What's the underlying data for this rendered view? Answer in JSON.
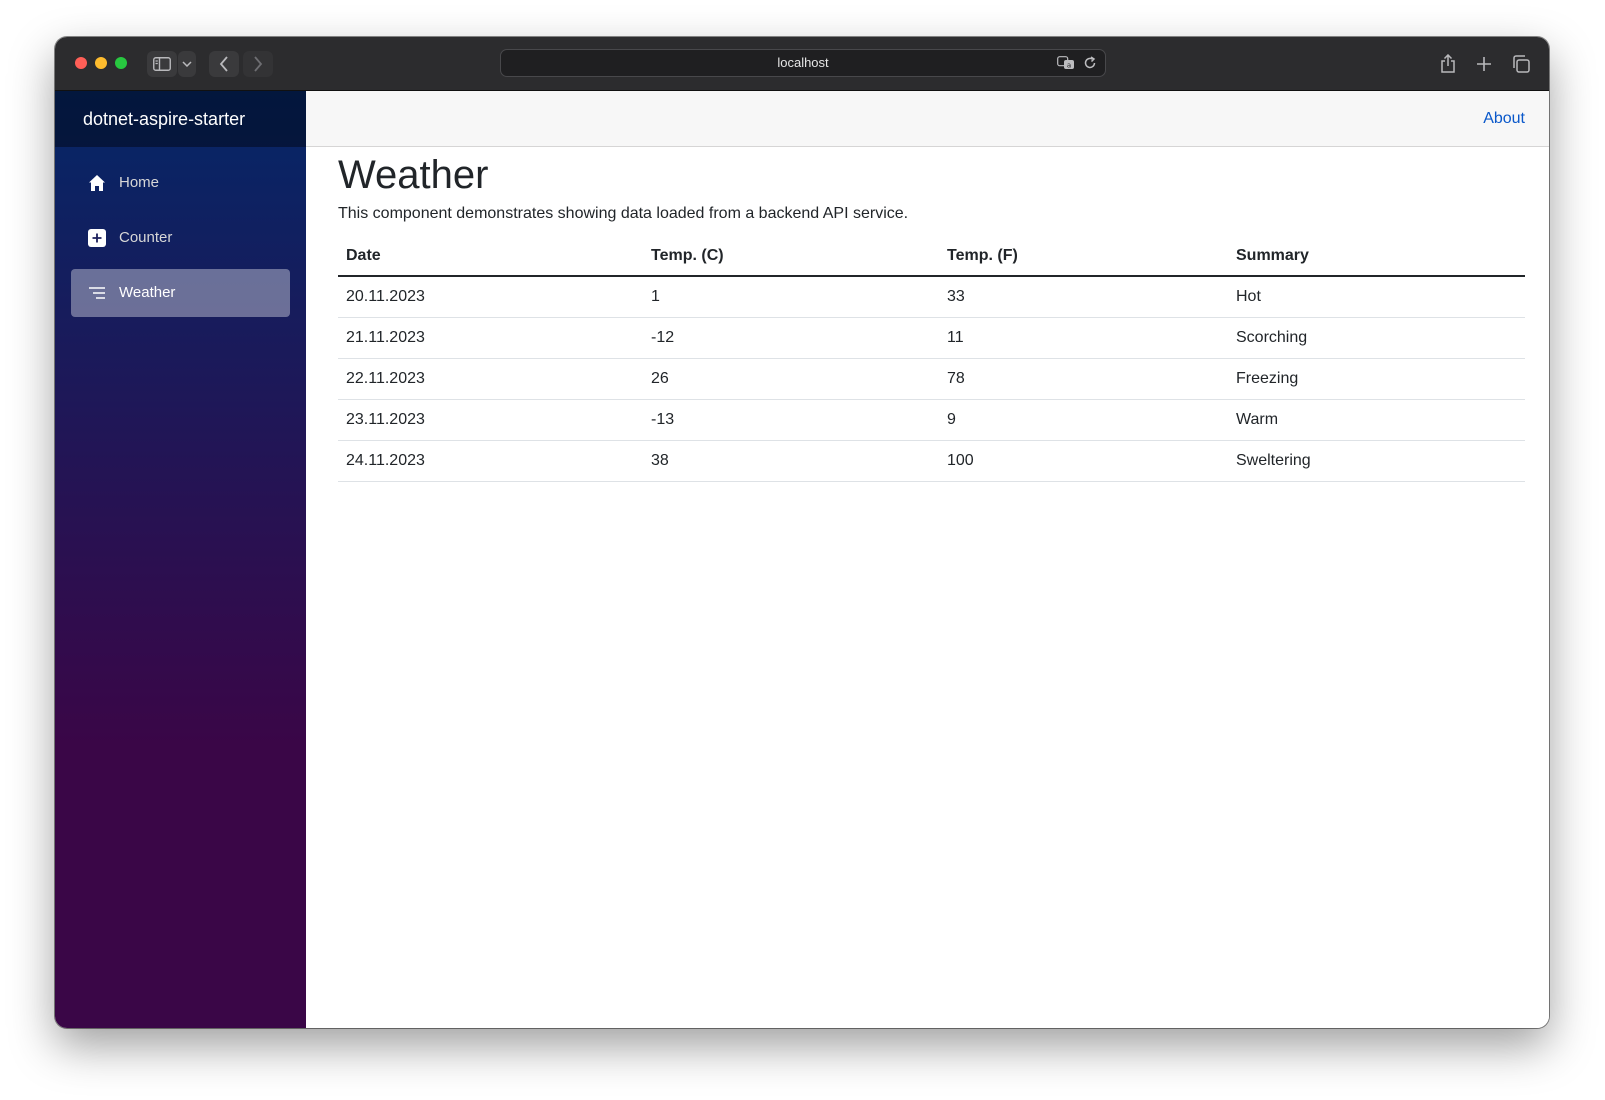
{
  "browser": {
    "url": "localhost"
  },
  "app": {
    "brand": "dotnet-aspire-starter",
    "nav": [
      {
        "label": "Home",
        "icon": "home-icon",
        "active": false
      },
      {
        "label": "Counter",
        "icon": "plus-square-icon",
        "active": false
      },
      {
        "label": "Weather",
        "icon": "list-icon",
        "active": true
      }
    ],
    "top_link": "About"
  },
  "page": {
    "title": "Weather",
    "description": "This component demonstrates showing data loaded from a backend API service.",
    "table": {
      "headers": [
        "Date",
        "Temp. (C)",
        "Temp. (F)",
        "Summary"
      ],
      "rows": [
        [
          "20.11.2023",
          "1",
          "33",
          "Hot"
        ],
        [
          "21.11.2023",
          "-12",
          "11",
          "Scorching"
        ],
        [
          "22.11.2023",
          "26",
          "78",
          "Freezing"
        ],
        [
          "23.11.2023",
          "-13",
          "9",
          "Warm"
        ],
        [
          "24.11.2023",
          "38",
          "100",
          "Sweltering"
        ]
      ]
    }
  },
  "colors": {
    "sidebar_top": "#052767",
    "sidebar_bottom": "#3a0647",
    "link": "#0a58ca",
    "text": "#212529"
  }
}
